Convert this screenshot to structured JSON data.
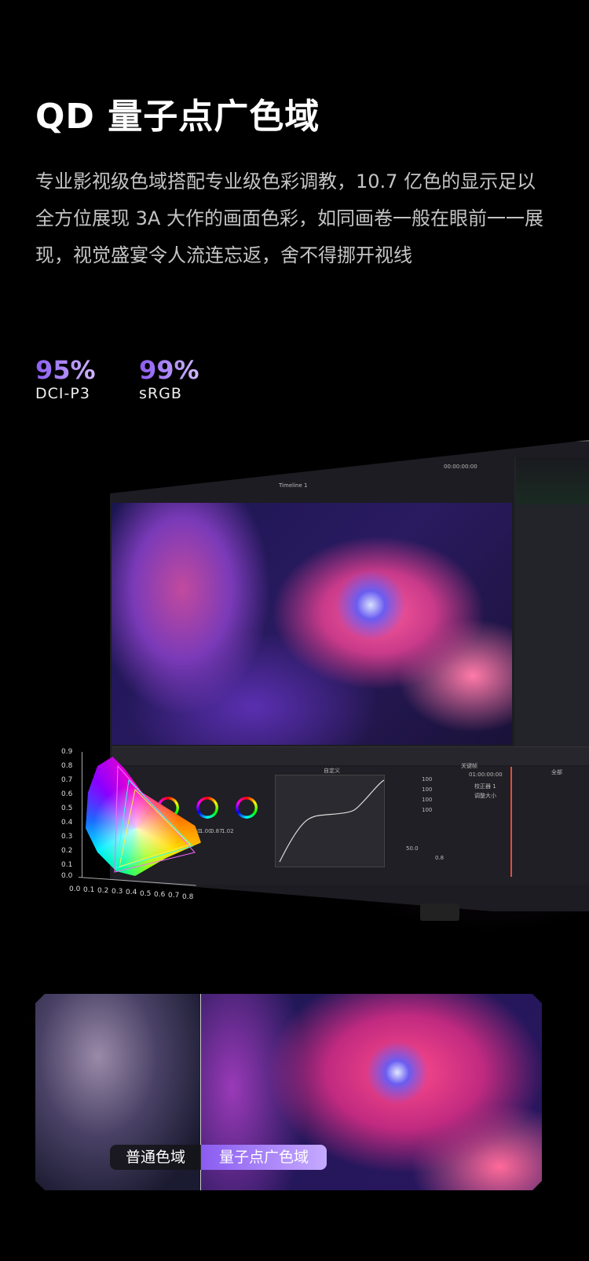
{
  "title": "QD 量子点广色域",
  "description": "专业影视级色域搭配专业级色彩调教，10.7 亿色的显示足以全方位展现 3A 大作的画面色彩，如同画卷一般在眼前一一展现，视觉盛宴令人流连忘返，舍不得挪开视线",
  "stats": [
    {
      "value": "95%",
      "label": "DCI-P3"
    },
    {
      "value": "99%",
      "label": "sRGB"
    }
  ],
  "monitor_ui": {
    "timeline": "Timeline 1",
    "timecode": "00:00:00:00",
    "timecode2": "01:00:00:00",
    "values": [
      "1.00",
      "1.00",
      "0.87",
      "1.02",
      "100",
      "100",
      "100",
      "100",
      "50.0",
      "0.8"
    ],
    "menu": "自定义",
    "keyframes": "关键帧",
    "all": "全部",
    "nodes": [
      "校正器 1",
      "调整大小"
    ]
  },
  "cie_chart": {
    "y_ticks": [
      "0.9",
      "0.8",
      "0.7",
      "0.6",
      "0.5",
      "0.4",
      "0.3",
      "0.2",
      "0.1",
      "0.0"
    ],
    "x_ticks": [
      "0.0",
      "0.1",
      "0.2",
      "0.3",
      "0.4",
      "0.5",
      "0.6",
      "0.7",
      "0.8"
    ]
  },
  "compare": {
    "left_label": "普通色域",
    "right_label": "量子点广色域"
  },
  "colors": {
    "accent": "#8a5cf0",
    "accent_light": "#c6aaff"
  }
}
